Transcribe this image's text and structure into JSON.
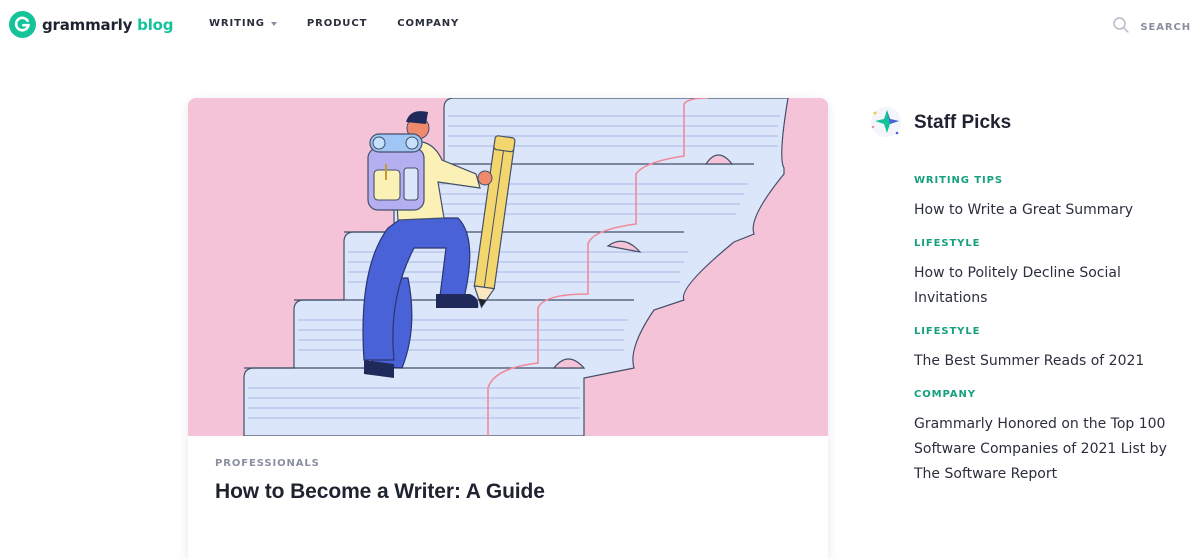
{
  "header": {
    "logo": {
      "word": "grammarly",
      "blog": "blog"
    },
    "nav": [
      {
        "label": "WRITING",
        "has_dropdown": true
      },
      {
        "label": "PRODUCT",
        "has_dropdown": false
      },
      {
        "label": "COMPANY",
        "has_dropdown": false
      }
    ],
    "search": {
      "label": "SEARCH",
      "icon": "search-icon"
    }
  },
  "featured": {
    "category": "PROFESSIONALS",
    "title": "How to Become a Writer: A Guide",
    "image": "climber-on-paper-stairs-illustration"
  },
  "staff_picks": {
    "title": "Staff Picks",
    "icon": "sparkle-star-icon",
    "items": [
      {
        "category": "WRITING TIPS",
        "title": "How to Write a Great Summary"
      },
      {
        "category": "LIFESTYLE",
        "title": "How to Politely Decline Social Invitations"
      },
      {
        "category": "LIFESTYLE",
        "title": "The Best Summer Reads of 2021"
      },
      {
        "category": "COMPANY",
        "title": "Grammarly Honored on the Top 100 Software Companies of 2021 List by The Software Report"
      }
    ]
  },
  "colors": {
    "brand_green": "#15c39a",
    "category_green": "#15a17e",
    "hero_pink": "#f5c3d8",
    "paper_blue": "#dbe6fb",
    "figure_blue": "#4a62d8"
  }
}
